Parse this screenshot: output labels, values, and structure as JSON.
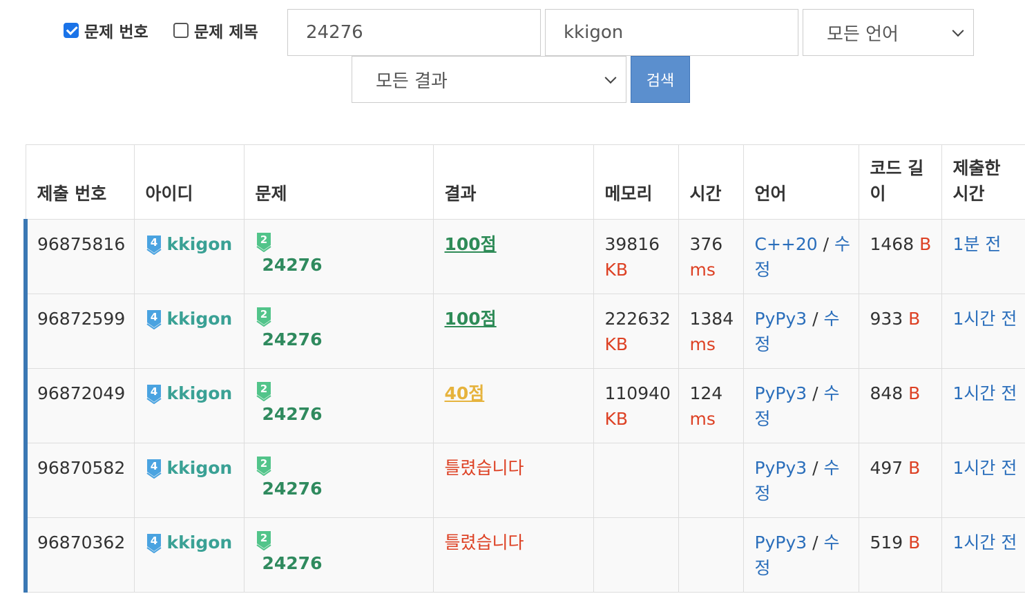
{
  "filters": {
    "checkbox_problem_id": {
      "label": "문제 번호",
      "checked": true
    },
    "checkbox_problem_title": {
      "label": "문제 제목",
      "checked": false
    },
    "problem_input": {
      "value": "24276"
    },
    "user_input": {
      "value": "kkigon"
    },
    "language_select": {
      "value": "모든 언어"
    },
    "result_select": {
      "value": "모든 결과"
    },
    "search_button": "검색"
  },
  "table": {
    "headers": [
      "제출 번호",
      "아이디",
      "문제",
      "결과",
      "메모리",
      "시간",
      "언어",
      "코드 길이",
      "제출한 시간"
    ],
    "edit_label": "수정",
    "rows": [
      {
        "id": "96875816",
        "user": "kkigon",
        "user_tier": "4",
        "problem": "24276",
        "problem_tier": "2",
        "result": "100점",
        "result_type": "ac",
        "memory": "39816",
        "memory_unit": "KB",
        "time": "376",
        "time_unit": "ms",
        "language": "C++20",
        "code_length": "1468",
        "code_unit": "B",
        "submitted": "1분 전"
      },
      {
        "id": "96872599",
        "user": "kkigon",
        "user_tier": "4",
        "problem": "24276",
        "problem_tier": "2",
        "result": "100점",
        "result_type": "ac",
        "memory": "222632",
        "memory_unit": "KB",
        "time": "1384",
        "time_unit": "ms",
        "language": "PyPy3",
        "code_length": "933",
        "code_unit": "B",
        "submitted": "1시간 전"
      },
      {
        "id": "96872049",
        "user": "kkigon",
        "user_tier": "4",
        "problem": "24276",
        "problem_tier": "2",
        "result": "40점",
        "result_type": "partial",
        "memory": "110940",
        "memory_unit": "KB",
        "time": "124",
        "time_unit": "ms",
        "language": "PyPy3",
        "code_length": "848",
        "code_unit": "B",
        "submitted": "1시간 전"
      },
      {
        "id": "96870582",
        "user": "kkigon",
        "user_tier": "4",
        "problem": "24276",
        "problem_tier": "2",
        "result": "틀렸습니다",
        "result_type": "wa",
        "memory": "",
        "memory_unit": "",
        "time": "",
        "time_unit": "",
        "language": "PyPy3",
        "code_length": "497",
        "code_unit": "B",
        "submitted": "1시간 전"
      },
      {
        "id": "96870362",
        "user": "kkigon",
        "user_tier": "4",
        "problem": "24276",
        "problem_tier": "2",
        "result": "틀렸습니다",
        "result_type": "wa",
        "memory": "",
        "memory_unit": "",
        "time": "",
        "time_unit": "",
        "language": "PyPy3",
        "code_length": "519",
        "code_unit": "B",
        "submitted": "1시간 전"
      }
    ]
  },
  "colors": {
    "user": "#3aa195",
    "problem": "#2f8a5e",
    "accepted": "#2e8b57",
    "partial": "#e6b33d",
    "wrong": "#dd4124",
    "link": "#2a6ebb",
    "search_button": "#5b8fce",
    "row_marker": "#3b78b4"
  },
  "icons": {
    "user_tier": "shield-badge-icon",
    "problem_tier": "shield-badge-icon"
  }
}
